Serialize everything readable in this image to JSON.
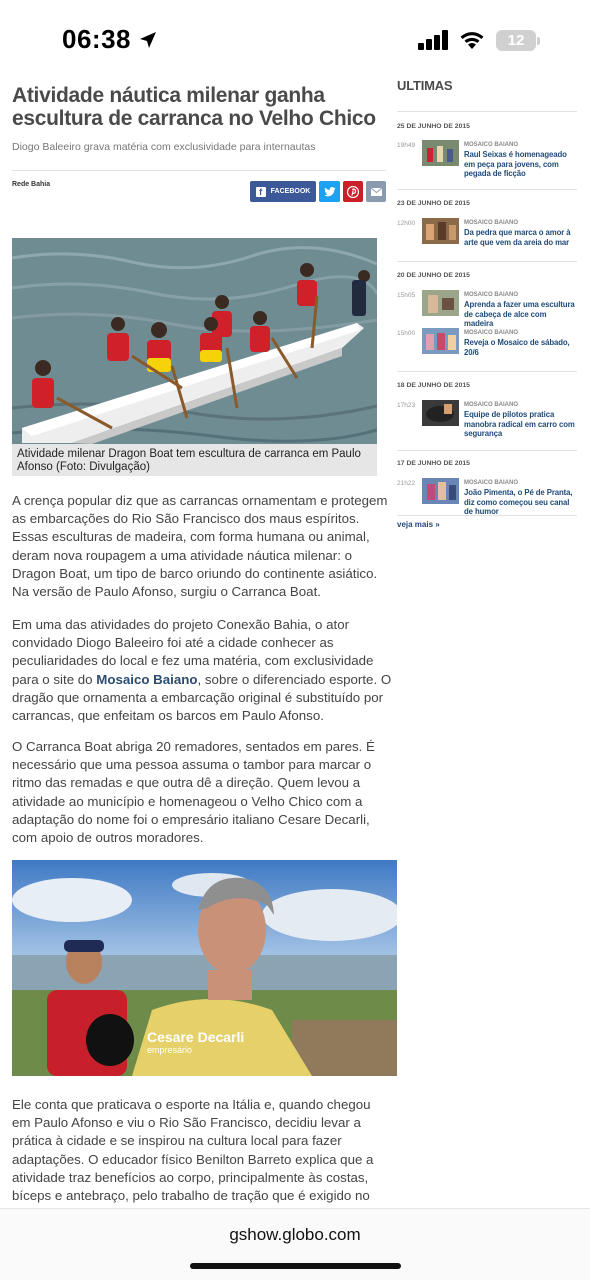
{
  "status_bar": {
    "time": "06:38",
    "battery": "12"
  },
  "article": {
    "title": "Atividade náutica milenar ganha escultura de carranca no Velho Chico",
    "subtitle": "Diogo Baleeiro grava matéria com exclusividade para internautas",
    "source": "Rede Bahia",
    "share": {
      "facebook": "FACEBOOK"
    },
    "photo_caption": "Atividade milenar Dragon Boat tem escultura de carranca em Paulo Afonso (Foto: Divulgação)",
    "p1": "A crença popular diz que as carrancas ornamentam e protegem as embarcações do Rio São Francisco dos maus espíritos. Essas esculturas de madeira, com forma humana ou animal, deram nova roupagem a uma atividade náutica milenar: o Dragon Boat, um tipo de barco oriundo do continente asiático. Na versão de Paulo Afonso, surgiu o Carranca Boat.",
    "p2_before": "Em uma das atividades do projeto Conexão Bahia, o ator convidado Diogo Baleeiro foi até a cidade conhecer as peculiaridades do local e fez uma matéria, com exclusividade para o site do ",
    "p2_link": "Mosaico Baiano",
    "p2_after": ", sobre o diferenciado esporte. O dragão que ornamenta a embarcação original é substituído por carrancas, que enfeitam os barcos em Paulo Afonso.",
    "p3": "O Carranca Boat abriga 20 remadores, sentados em pares. É necessário que uma pessoa assuma o tambor para marcar o ritmo das remadas e que outra dê a direção. Quem levou a atividade ao município e homenageou o Velho Chico com a adaptação do nome foi o empresário italiano Cesare Decarli, com apoio de outros moradores.",
    "video_name": "Cesare Decarli",
    "video_role": "empresário",
    "p4": "Ele conta que praticava o esporte na Itália e, quando chegou em Paulo Afonso e viu o Rio São Francisco, decidiu levar a prática à cidade e se inspirou na cultura local para fazer adaptações. O educador físico Benilton Barreto explica que a atividade traz benefícios ao corpo, principalmente às costas, bíceps e antebraço, pelo trabalho de tração que é exigido no remo."
  },
  "sidebar": {
    "title": "ULTIMAS",
    "dates": [
      "25 DE JUNHO DE 2015",
      "23 DE JUNHO DE 2015",
      "20 DE JUNHO DE 2015",
      "18 DE JUNHO DE 2015",
      "17 DE JUNHO DE 2015"
    ],
    "items": [
      {
        "time": "19h49",
        "category": "MOSAICO BAIANO",
        "headline": "Raul Seixas é homenageado em peça para jovens, com pegada de ficção"
      },
      {
        "time": "12h00",
        "category": "MOSAICO BAIANO",
        "headline": "Da pedra que marca o amor à arte que vem da areia do mar"
      },
      {
        "time": "15h05",
        "category": "MOSAICO BAIANO",
        "headline": "Aprenda a fazer uma escultura de cabeça de alce com madeira"
      },
      {
        "time": "15h00",
        "category": "MOSAICO BAIANO",
        "headline": "Reveja o Mosaico de sábado, 20/6"
      },
      {
        "time": "17h23",
        "category": "MOSAICO BAIANO",
        "headline": "Equipe de pilotos pratica manobra radical em carro com segurança"
      },
      {
        "time": "21h22",
        "category": "MOSAICO BAIANO",
        "headline": "João Pimenta, o Pé de Pranta, diz como começou seu canal de humor"
      }
    ],
    "see_more": "veja mais »"
  },
  "browser": {
    "url": "gshow.globo.com"
  },
  "colors": {
    "facebook": "#3b5998",
    "twitter": "#1da1f2",
    "pinterest": "#cb2027",
    "link": "#1e4b7a"
  }
}
